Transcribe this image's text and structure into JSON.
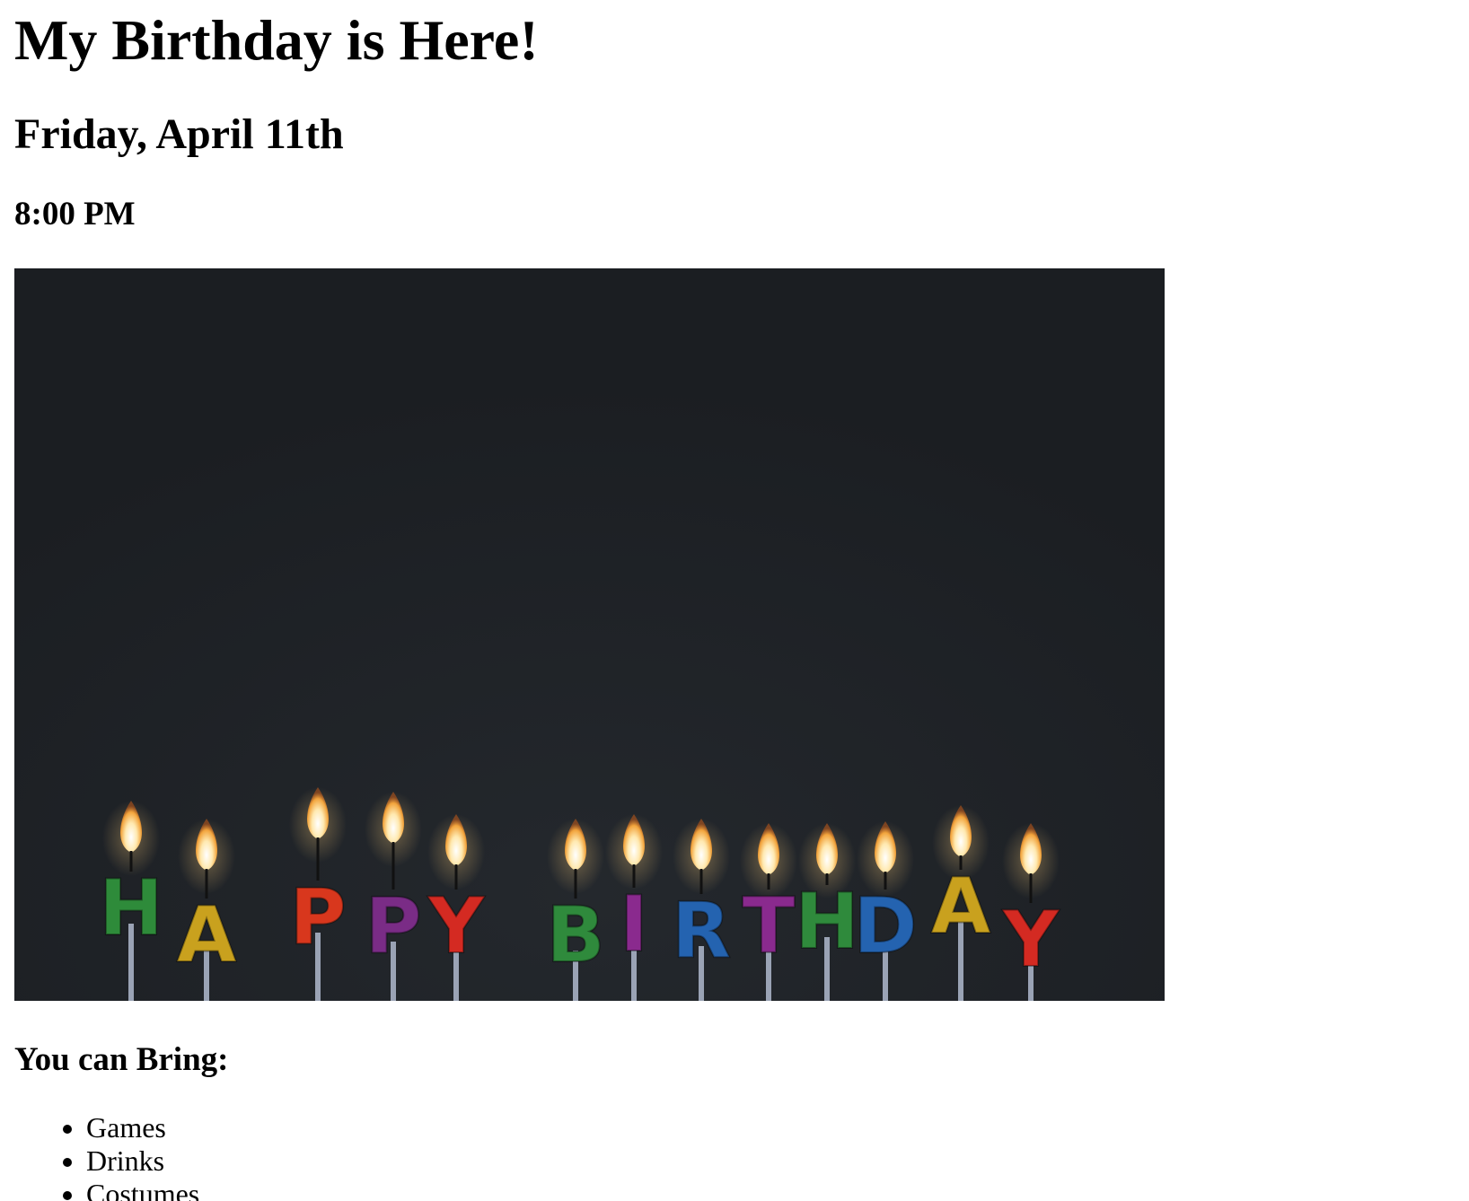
{
  "header": {
    "title": "My Birthday is Here!",
    "date": "Friday, April 11th",
    "time": "8:00 PM"
  },
  "photo": {
    "candle_letters": [
      "H",
      "A",
      "P",
      "P",
      "Y",
      "B",
      "I",
      "R",
      "T",
      "H",
      "D",
      "A",
      "Y"
    ],
    "candle_colors": [
      "#2e8b3a",
      "#c9a11e",
      "#d8371d",
      "#7a2c86",
      "#d42a22",
      "#2f8a3c",
      "#8a2a8e",
      "#2463b0",
      "#8a2a8e",
      "#2f8a3c",
      "#2463b0",
      "#c9a11e",
      "#d42a22"
    ],
    "background_color": "#1e2125"
  },
  "bring": {
    "heading": "You can Bring:",
    "items": [
      "Games",
      "Drinks",
      "Costumes"
    ]
  }
}
